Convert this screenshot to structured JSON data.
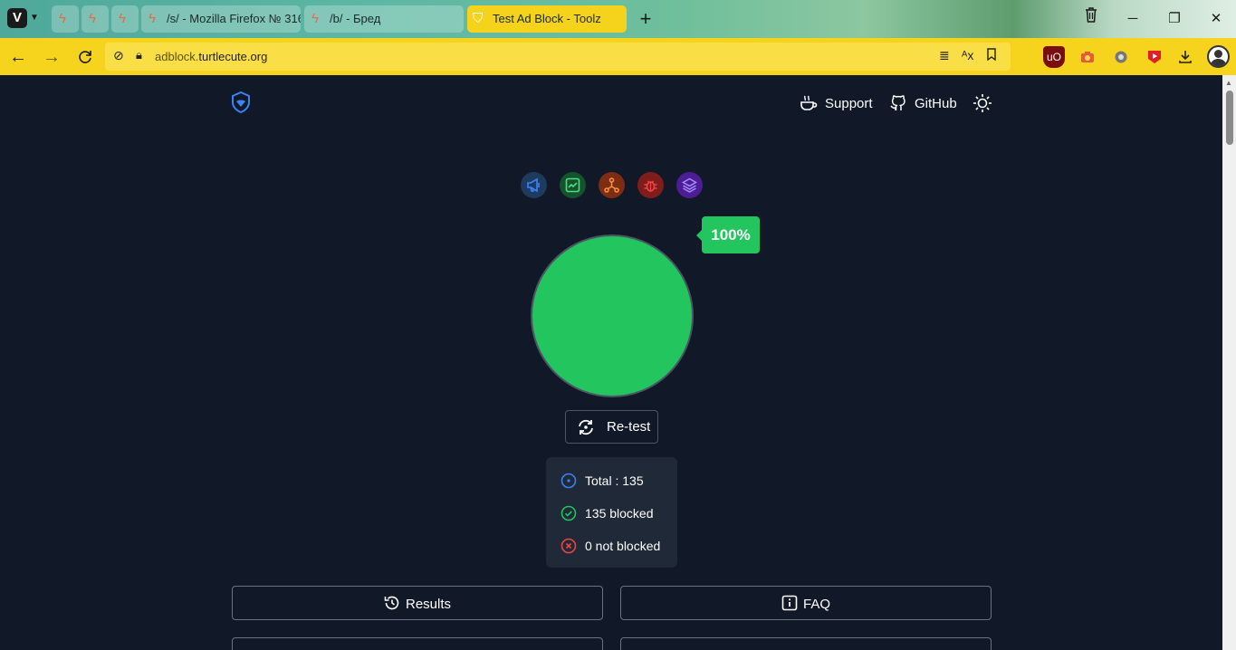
{
  "browser": {
    "tabs": [
      {
        "label": "",
        "pinned": true,
        "icon": "bolt-icon"
      },
      {
        "label": "",
        "pinned": true,
        "icon": "bolt-alert-icon"
      },
      {
        "label": "",
        "pinned": true,
        "icon": "bolt-icon"
      },
      {
        "label": "/s/ - Mozilla Firefox № 316",
        "pinned": false,
        "icon": "bolt-icon"
      },
      {
        "label": "/b/ - Бред",
        "pinned": false,
        "icon": "bolt-icon"
      },
      {
        "label": "Test Ad Block - Toolz",
        "pinned": false,
        "active": true,
        "icon": "shield-icon"
      }
    ],
    "url_subdomain": "adblock.",
    "url_domain": "turtlecute.org",
    "accent": "#f6d41d"
  },
  "nav": {
    "support": "Support",
    "github": "GitHub"
  },
  "categories": [
    "megaphone-icon",
    "chart-icon",
    "network-icon",
    "bug-icon",
    "layers-icon"
  ],
  "result": {
    "percent_label": "100%",
    "blocked_fraction": 1.0,
    "blocked_color": "#22c55e",
    "retest_label": "Re-test"
  },
  "stats": {
    "total": "Total : 135",
    "blocked": "135 blocked",
    "not_blocked": "0 not blocked"
  },
  "buttons": {
    "results": "Results",
    "faq": "FAQ"
  }
}
